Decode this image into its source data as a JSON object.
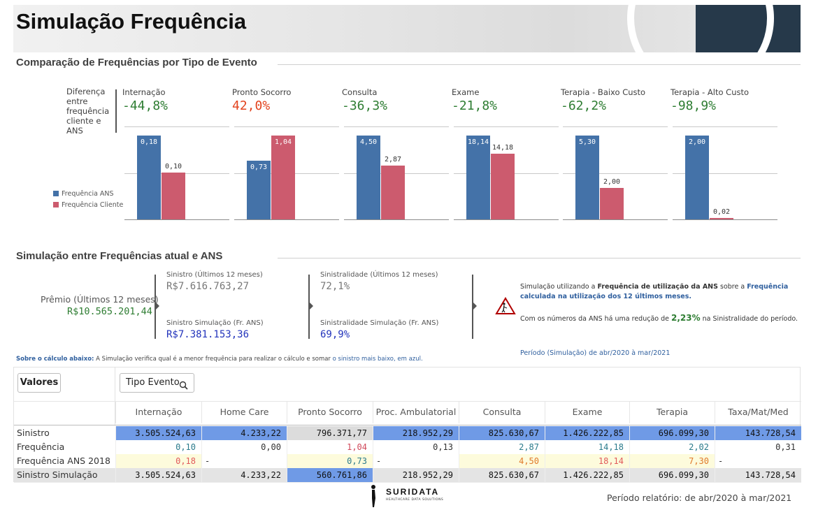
{
  "header": {
    "title": "Simulação Frequência"
  },
  "colors": {
    "ans": "#4472a8",
    "cliente": "#cc5b6e",
    "negative": "#2e7d32",
    "positive": "#e2431e",
    "link": "#2f5f9e",
    "highlight_blue": "#6f9ae6",
    "highlight_yellow": "#fdfbdc",
    "grey_row": "#e4e4e4"
  },
  "section1": {
    "title": "Comparação de Frequências por Tipo de Evento",
    "diff_label": "Diferença entre frequência cliente e ANS",
    "legend": [
      {
        "label": "Frequência ANS",
        "color": "#4472a8"
      },
      {
        "label": "Frequência Cliente",
        "color": "#cc5b6e"
      }
    ]
  },
  "chart_data": {
    "type": "bar",
    "panels": [
      {
        "title": "Internação",
        "diff": "-44,8%",
        "diff_sign": "neg",
        "ans": 0.18,
        "cliente": 0.1,
        "ans_label": "0,18",
        "cliente_label": "0,10"
      },
      {
        "title": "Pronto Socorro",
        "diff": "42,0%",
        "diff_sign": "pos",
        "ans": 0.73,
        "cliente": 1.04,
        "ans_label": "0,73",
        "cliente_label": "1,04"
      },
      {
        "title": "Consulta",
        "diff": "-36,3%",
        "diff_sign": "neg",
        "ans": 4.5,
        "cliente": 2.87,
        "ans_label": "4,50",
        "cliente_label": "2,87"
      },
      {
        "title": "Exame",
        "diff": "-21,8%",
        "diff_sign": "neg",
        "ans": 18.14,
        "cliente": 14.18,
        "ans_label": "18,14",
        "cliente_label": "14,18"
      },
      {
        "title": "Terapia - Baixo Custo",
        "diff": "-62,2%",
        "diff_sign": "neg",
        "ans": 5.3,
        "cliente": 2.0,
        "ans_label": "5,30",
        "cliente_label": "2,00"
      },
      {
        "title": "Terapia - Alto Custo",
        "diff": "-98,9%",
        "diff_sign": "neg",
        "ans": 2.0,
        "cliente": 0.02,
        "ans_label": "2,00",
        "cliente_label": "0,02"
      }
    ],
    "series": [
      {
        "name": "Frequência ANS"
      },
      {
        "name": "Frequência Cliente"
      }
    ]
  },
  "section2": {
    "title": "Simulação entre Frequências atual e ANS",
    "premio_label": "Prêmio (Últimos 12 meses)",
    "premio_value": "R$10.565.201,44",
    "sinistro_label": "Sinistro (Últimos 12 meses)",
    "sinistro_value": "R$7.616.763,27",
    "sinistro_sim_label": "Sinistro Simulação (Fr. ANS)",
    "sinistro_sim_value": "R$7.381.153,36",
    "sinistralidade_label": "Sinistralidade (Últimos 12 meses)",
    "sinistralidade_value": "72,1%",
    "sinistralidade_sim_label": "Sinistralidade Simulação (Fr. ANS)",
    "sinistralidade_sim_value": "69,9%",
    "note_p1_a": "Simulação utilizando a ",
    "note_p1_b": "Frequência de utilização da ANS",
    "note_p1_c": " sobre a ",
    "note_p1_d": "Frequência calculada na utilização dos 12 últimos meses.",
    "note_p2_a": "Com os números da ANS há uma redução de ",
    "note_p2_b": "2,23%",
    "note_p2_c": " na Sinistralidade do período.",
    "periodo": "Período (Simulação) de abr/2020 à mar/2021"
  },
  "about": {
    "bold": "Sobre o cálculo abaixo:",
    "text": " A Simulação verifica qual é a menor frequência para realizar o cálculo e somar ",
    "link": "o sinistro mais baixo, em azul."
  },
  "table": {
    "valores_btn": "Valores",
    "tipo_evento_btn": "Tipo Evento",
    "columns": [
      "Internação",
      "Home Care",
      "Pronto Socorro",
      "Proc. Ambulatorial",
      "Consulta",
      "Exame",
      "Terapia",
      "Taxa/Mat/Med"
    ],
    "rows": [
      {
        "label": "Sinistro",
        "cells": [
          "3.505.524,63",
          "4.233,22",
          "796.371,77",
          "218.952,29",
          "825.630,67",
          "1.426.222,85",
          "696.099,30",
          "143.728,54"
        ]
      },
      {
        "label": "Frequência",
        "cells": [
          "0,10",
          "0,00",
          "1,04",
          "0,13",
          "2,87",
          "14,18",
          "2,02",
          "0,31"
        ]
      },
      {
        "label": "Frequência ANS 2018",
        "cells": [
          "0,18",
          "-",
          "0,73",
          "-",
          "4,50",
          "18,14",
          "7,30",
          "-"
        ]
      },
      {
        "label": "Sinistro Simulação",
        "cells": [
          "3.505.524,63",
          "4.233,22",
          "560.761,86",
          "218.952,29",
          "825.630,67",
          "1.426.222,85",
          "696.099,30",
          "143.728,54"
        ]
      }
    ]
  },
  "footer": {
    "logo_text": "SURIDATA",
    "logo_sub": "HEALTHCARE DATA SOLUTIONS",
    "periodo": "Período relatório: de abr/2020 à mar/2021"
  }
}
